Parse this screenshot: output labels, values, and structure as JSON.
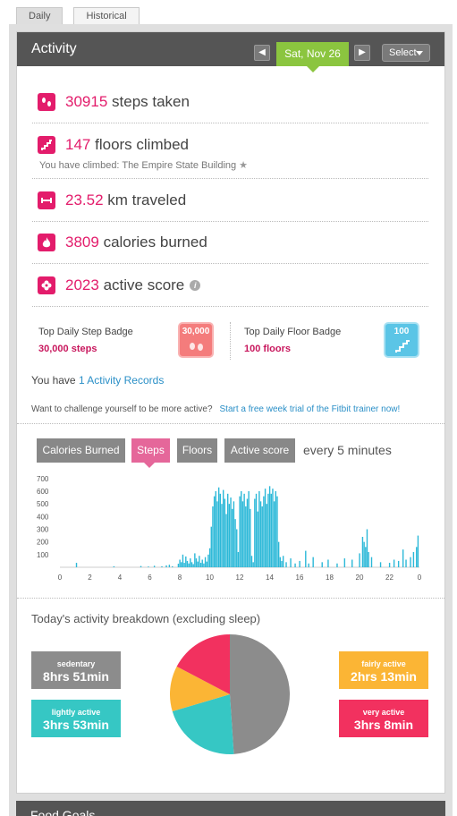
{
  "tabs": [
    "Daily",
    "Historical"
  ],
  "header": {
    "title": "Activity",
    "date": "Sat, Nov 26",
    "prev": "◀",
    "next": "▶",
    "select": "Select"
  },
  "stats": [
    {
      "value": "30915",
      "label": "steps taken",
      "icon": "footprints-icon"
    },
    {
      "value": "147",
      "label": "floors climbed",
      "icon": "stairs-icon"
    },
    {
      "value": "23.52",
      "label": "km traveled",
      "icon": "distance-icon"
    },
    {
      "value": "3809",
      "label": "calories burned",
      "icon": "flame-icon"
    },
    {
      "value": "2023",
      "label": "active score",
      "icon": "flower-icon"
    }
  ],
  "floors_note": "You have climbed: The Empire State Building",
  "badges": {
    "step": {
      "label": "Top Daily Step Badge",
      "value": "30,000 steps",
      "badge_text": "30,000"
    },
    "floor": {
      "label": "Top Daily Floor Badge",
      "value": "100 floors",
      "badge_text": "100"
    }
  },
  "records": {
    "prefix": "You have",
    "link": "1 Activity Records"
  },
  "challenge": {
    "text": "Want to challenge yourself to be more active?",
    "link": "Start a free week trial of the Fitbit trainer now!"
  },
  "chart_tabs": [
    "Calories Burned",
    "Steps",
    "Floors",
    "Active score"
  ],
  "chart_interval": "every 5 minutes",
  "chart_data": {
    "type": "bar",
    "title": "",
    "xlabel": "",
    "ylabel": "",
    "x_ticks": [
      "0",
      "2",
      "4",
      "6",
      "8",
      "10",
      "12",
      "14",
      "16",
      "18",
      "20",
      "22",
      "0"
    ],
    "y_ticks": [
      "700",
      "600",
      "500",
      "400",
      "300",
      "200",
      "100"
    ],
    "ylim": [
      0,
      720
    ],
    "xlim": [
      0,
      24
    ],
    "interval_minutes": 5,
    "series": [
      {
        "color": "#2bb8d8",
        "points": [
          [
            1.1,
            35
          ],
          [
            3.6,
            8
          ],
          [
            5.4,
            10
          ],
          [
            5.9,
            6
          ],
          [
            6.3,
            12
          ],
          [
            6.8,
            8
          ],
          [
            7.1,
            15
          ],
          [
            7.3,
            20
          ],
          [
            7.5,
            8
          ],
          [
            7.9,
            28
          ],
          [
            8.0,
            60
          ],
          [
            8.1,
            40
          ],
          [
            8.2,
            100
          ],
          [
            8.3,
            35
          ],
          [
            8.4,
            85
          ],
          [
            8.5,
            50
          ],
          [
            8.6,
            30
          ],
          [
            8.7,
            70
          ],
          [
            8.8,
            40
          ],
          [
            8.9,
            25
          ],
          [
            9.0,
            110
          ],
          [
            9.1,
            70
          ],
          [
            9.2,
            45
          ],
          [
            9.3,
            90
          ],
          [
            9.4,
            35
          ],
          [
            9.5,
            60
          ],
          [
            9.6,
            30
          ],
          [
            9.7,
            80
          ],
          [
            9.8,
            45
          ],
          [
            9.9,
            100
          ],
          [
            10.0,
            150
          ],
          [
            10.1,
            320
          ],
          [
            10.2,
            480
          ],
          [
            10.3,
            560
          ],
          [
            10.4,
            600
          ],
          [
            10.5,
            520
          ],
          [
            10.6,
            630
          ],
          [
            10.7,
            580
          ],
          [
            10.8,
            500
          ],
          [
            10.9,
            610
          ],
          [
            11.0,
            540
          ],
          [
            11.1,
            420
          ],
          [
            11.2,
            580
          ],
          [
            11.3,
            500
          ],
          [
            11.4,
            550
          ],
          [
            11.5,
            460
          ],
          [
            11.6,
            520
          ],
          [
            11.7,
            380
          ],
          [
            11.8,
            300
          ],
          [
            11.9,
            120
          ],
          [
            12.0,
            560
          ],
          [
            12.1,
            600
          ],
          [
            12.2,
            520
          ],
          [
            12.3,
            580
          ],
          [
            12.4,
            480
          ],
          [
            12.5,
            540
          ],
          [
            12.6,
            600
          ],
          [
            12.7,
            460
          ],
          [
            12.8,
            90
          ],
          [
            12.9,
            40
          ],
          [
            13.0,
            540
          ],
          [
            13.1,
            580
          ],
          [
            13.2,
            440
          ],
          [
            13.3,
            600
          ],
          [
            13.4,
            520
          ],
          [
            13.5,
            480
          ],
          [
            13.6,
            560
          ],
          [
            13.7,
            620
          ],
          [
            13.8,
            500
          ],
          [
            13.9,
            580
          ],
          [
            14.0,
            640
          ],
          [
            14.1,
            580
          ],
          [
            14.2,
            620
          ],
          [
            14.3,
            520
          ],
          [
            14.4,
            600
          ],
          [
            14.5,
            560
          ],
          [
            14.6,
            200
          ],
          [
            14.7,
            80
          ],
          [
            14.8,
            50
          ],
          [
            14.9,
            90
          ],
          [
            15.1,
            40
          ],
          [
            15.4,
            70
          ],
          [
            15.7,
            30
          ],
          [
            16.0,
            50
          ],
          [
            16.4,
            130
          ],
          [
            16.6,
            30
          ],
          [
            16.9,
            80
          ],
          [
            17.5,
            40
          ],
          [
            17.9,
            60
          ],
          [
            18.5,
            30
          ],
          [
            19.0,
            70
          ],
          [
            19.5,
            60
          ],
          [
            20.0,
            110
          ],
          [
            20.2,
            240
          ],
          [
            20.3,
            200
          ],
          [
            20.4,
            160
          ],
          [
            20.5,
            300
          ],
          [
            20.6,
            120
          ],
          [
            20.8,
            80
          ],
          [
            21.4,
            40
          ],
          [
            22.0,
            35
          ],
          [
            22.3,
            60
          ],
          [
            22.6,
            50
          ],
          [
            22.9,
            140
          ],
          [
            23.1,
            60
          ],
          [
            23.4,
            80
          ],
          [
            23.6,
            120
          ],
          [
            23.8,
            160
          ],
          [
            23.9,
            250
          ]
        ]
      }
    ]
  },
  "breakdown": {
    "title": "Today's activity breakdown (excluding sleep)",
    "categories": [
      {
        "name": "sedentary",
        "time": "8hrs 51min",
        "minutes": 531,
        "color": "#8c8c8c"
      },
      {
        "name": "lightly active",
        "time": "3hrs 53min",
        "minutes": 233,
        "color": "#36c7c4"
      },
      {
        "name": "fairly active",
        "time": "2hrs 13min",
        "minutes": 133,
        "color": "#fbb535"
      },
      {
        "name": "very active",
        "time": "3hrs 8min",
        "minutes": 188,
        "color": "#f2315f"
      }
    ]
  },
  "bottom_header": "Food Goals",
  "colors": {
    "accent": "#e31c6b",
    "date": "#8bc53f",
    "link": "#2a8fc7",
    "header": "#555555"
  }
}
